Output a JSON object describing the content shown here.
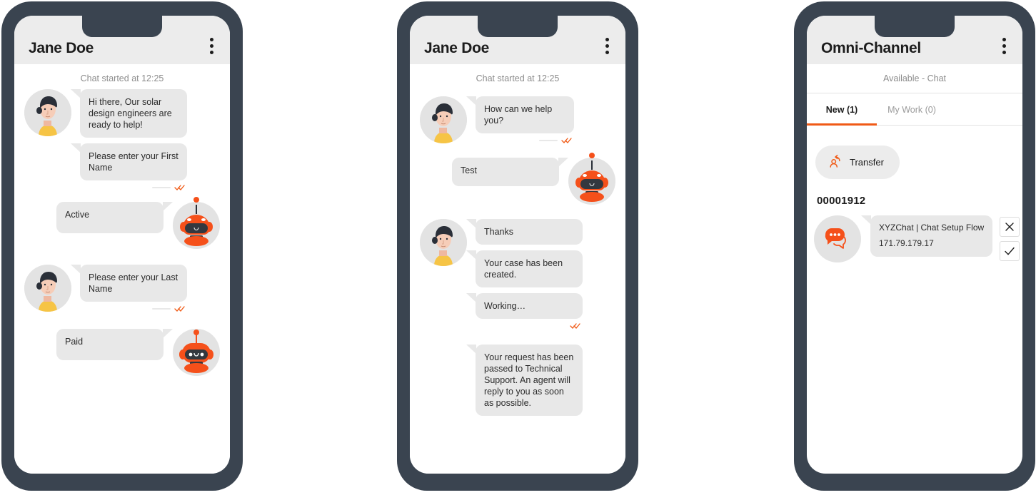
{
  "theme": {
    "bezel": "#3a4450",
    "header_bg": "#ececec",
    "bubble_bg": "#e8e8e8",
    "accent": "#f05a16",
    "text": "#1c1c1c",
    "muted": "#8c8c8c"
  },
  "phone1": {
    "header": {
      "title": "Jane Doe",
      "menu_icon": "kebab-menu-icon"
    },
    "chat_started": "Chat started at 12:25",
    "messages": [
      {
        "side": "left",
        "avatar": "agent-woman-avatar",
        "bubbles": [
          "Hi there, Our solar design engineers are ready to help!",
          "Please enter your First Name"
        ],
        "receipt": true
      },
      {
        "side": "right",
        "avatar": "bot-visor-avatar",
        "bubbles": [
          "Active"
        ],
        "receipt": false
      },
      {
        "side": "left",
        "avatar": "agent-woman-avatar",
        "bubbles": [
          "Please enter your Last Name"
        ],
        "receipt": true
      },
      {
        "side": "right",
        "avatar": "bot-face-avatar",
        "bubbles": [
          "Paid"
        ],
        "receipt": false
      }
    ]
  },
  "phone2": {
    "header": {
      "title": "Jane Doe",
      "menu_icon": "kebab-menu-icon"
    },
    "chat_started": "Chat started at 12:25",
    "messages": [
      {
        "side": "left",
        "avatar": "agent-woman-avatar",
        "bubbles": [
          "How can we help you?"
        ],
        "receipt": true
      },
      {
        "side": "right",
        "avatar": "bot-visor-avatar",
        "bubbles": [
          "Test"
        ],
        "receipt": false
      },
      {
        "side": "left",
        "avatar": "agent-woman-avatar",
        "bubbles": [
          "Thanks",
          "Your case has been created.",
          "Working…"
        ],
        "receipt": true
      },
      {
        "side": "left-noavatar",
        "avatar": null,
        "bubbles": [
          "Your request has been passed to Technical Support. An agent will reply to you as soon as possible."
        ],
        "receipt": false
      }
    ]
  },
  "phone3": {
    "header": {
      "title": "Omni-Channel",
      "menu_icon": "kebab-menu-icon"
    },
    "status": "Available - Chat",
    "tabs": [
      {
        "label": "New (1)",
        "active": true
      },
      {
        "label": "My Work (0)",
        "active": false
      }
    ],
    "transfer_button": {
      "label": "Transfer",
      "icon": "transfer-person-icon"
    },
    "work_id": "00001912",
    "work_item": {
      "avatar_icon": "chat-bubbles-icon",
      "title": "XYZChat | Chat Setup Flow",
      "ip": "171.79.179.17",
      "decline_icon": "close-icon",
      "accept_icon": "check-icon"
    }
  }
}
